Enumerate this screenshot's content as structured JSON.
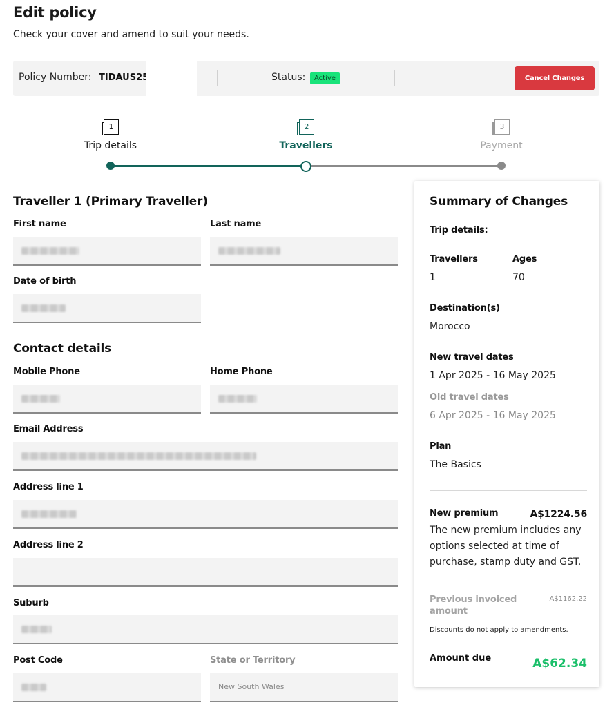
{
  "header": {
    "title": "Edit policy",
    "subtitle": "Check your cover and amend to suit your needs."
  },
  "policy_bar": {
    "policy_number_label": "Policy Number:",
    "policy_number": "TIDAUS25",
    "status_label": "Status:",
    "status_value": "Active",
    "status_color": "#19e37a",
    "cancel_label": "Cancel Changes",
    "cancel_color": "#d9393f"
  },
  "stepper": {
    "accent_color": "#12645a",
    "steps": [
      {
        "number": "1",
        "label": "Trip details",
        "state": "complete"
      },
      {
        "number": "2",
        "label": "Travellers",
        "state": "current"
      },
      {
        "number": "3",
        "label": "Payment",
        "state": "upcoming"
      }
    ]
  },
  "traveller": {
    "section_title": "Traveller 1 (Primary Traveller)",
    "first_name_label": "First name",
    "last_name_label": "Last name",
    "dob_label": "Date of birth"
  },
  "contact": {
    "section_title": "Contact details",
    "mobile_label": "Mobile Phone",
    "home_label": "Home Phone",
    "email_label": "Email Address",
    "address1_label": "Address line 1",
    "address2_label": "Address line 2",
    "suburb_label": "Suburb",
    "postcode_label": "Post Code",
    "state_label": "State or Territory",
    "state_value": "New South Wales"
  },
  "summary": {
    "title": "Summary of Changes",
    "trip_details_label": "Trip details:",
    "travellers_label": "Travellers",
    "travellers_value": "1",
    "ages_label": "Ages",
    "ages_value": "70",
    "destinations_label": "Destination(s)",
    "destinations_value": "Morocco",
    "new_dates_label": "New travel dates",
    "new_dates_value": "1 Apr 2025 - 16 May 2025",
    "old_dates_label": "Old travel dates",
    "old_dates_value": "6 Apr 2025 - 16 May 2025",
    "plan_label": "Plan",
    "plan_value": "The Basics",
    "new_premium_label": "New premium",
    "new_premium_value": "A$1224.56",
    "premium_note": "The new premium includes any options selected at time of purchase, stamp duty and GST.",
    "previous_label": "Previous invoiced amount",
    "previous_value": "A$1162.22",
    "discount_note": "Discounts do not apply to amendments.",
    "amount_due_label": "Amount due",
    "amount_due_value": "A$62.34",
    "amount_due_color": "#1bbf6a"
  }
}
